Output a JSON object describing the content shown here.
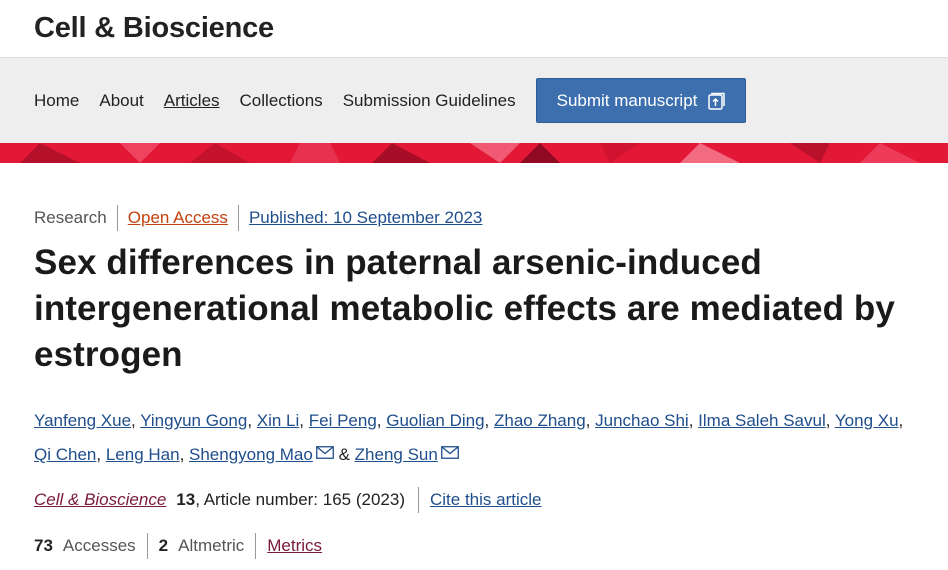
{
  "header": {
    "journal_title": "Cell & Bioscience"
  },
  "nav": {
    "items": [
      "Home",
      "About",
      "Articles",
      "Collections",
      "Submission Guidelines"
    ],
    "submit_label": "Submit manuscript"
  },
  "colors": {
    "brand_red": "#e31837",
    "button_blue": "#3d6fae",
    "link_blue": "#1f4e8c",
    "link_maroon": "#7a1a3a",
    "open_access_orange": "#c2410c"
  },
  "article": {
    "type": "Research",
    "access": "Open Access",
    "published": "Published: 10 September 2023",
    "title": "Sex differences in paternal arsenic-induced intergenerational metabolic effects are mediated by estrogen",
    "authors": [
      "Yanfeng Xue",
      "Yingyun Gong",
      "Xin Li",
      "Fei Peng",
      "Guolian Ding",
      "Zhao Zhang",
      "Junchao Shi",
      "Ilma Saleh Savul",
      "Yong Xu",
      "Qi Chen",
      "Leng Han",
      "Shengyong Mao",
      "Zheng Sun"
    ],
    "author_conjunction": "&",
    "journal": "Cell & Bioscience",
    "volume": "13",
    "article_number_text": ", Article number: 165 (2023)",
    "cite_label": "Cite this article"
  },
  "metrics": {
    "accesses_count": "73",
    "accesses_label": "Accesses",
    "altmetric_count": "2",
    "altmetric_label": "Altmetric",
    "metrics_link": "Metrics"
  }
}
